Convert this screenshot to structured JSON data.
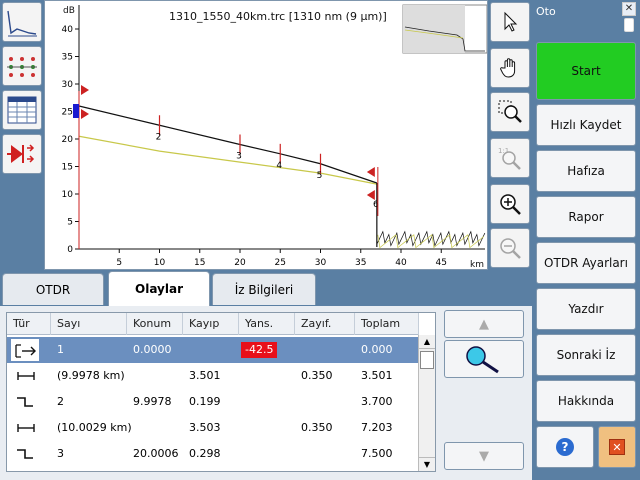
{
  "graph": {
    "title": "1310_1550_40km.trc [1310 nm (9 µm)]",
    "y_unit": "dB",
    "x_unit": "km",
    "y_ticks": [
      "40",
      "35",
      "30",
      "25",
      "20",
      "15",
      "10",
      "5",
      "0"
    ],
    "x_ticks": [
      "5",
      "10",
      "15",
      "20",
      "25",
      "30",
      "35",
      "40",
      "45"
    ],
    "event_labels": [
      "2",
      "3",
      "4",
      "5",
      "6"
    ]
  },
  "left_tools": [
    "trace-view-icon",
    "event-list-icon",
    "table-icon",
    "laser-icon"
  ],
  "tool_col": [
    "pointer-icon",
    "hand-icon",
    "zoom-area-icon",
    "zoom-reset-icon",
    "zoom-in-icon",
    "zoom-out-icon"
  ],
  "right": {
    "title": "Oto",
    "buttons": [
      "Start",
      "Hızlı Kaydet",
      "Hafıza",
      "Rapor",
      "OTDR Ayarları",
      "Yazdır",
      "Sonraki İz",
      "Hakkında"
    ]
  },
  "tabs": [
    "OTDR",
    "Olaylar",
    "İz Bilgileri"
  ],
  "table": {
    "headers": [
      "Tür",
      "Sayı",
      "Konum",
      "Kayıp",
      "Yans.",
      "Zayıf.",
      "Toplam"
    ],
    "rows": [
      {
        "type": "start-icon",
        "sayi": "1",
        "konum": "0.0000",
        "kayip": "",
        "yans": "-42.5",
        "zayif": "",
        "toplam": "0.000"
      },
      {
        "type": "span-icon",
        "sayi": "(9.9978 km)",
        "konum": "",
        "kayip": "3.501",
        "yans": "",
        "zayif": "0.350",
        "toplam": "3.501"
      },
      {
        "type": "splice-icon",
        "sayi": "2",
        "konum": "9.9978",
        "kayip": "0.199",
        "yans": "",
        "zayif": "",
        "toplam": "3.700"
      },
      {
        "type": "span-icon",
        "sayi": "(10.0029 km)",
        "konum": "",
        "kayip": "3.503",
        "yans": "",
        "zayif": "0.350",
        "toplam": "7.203"
      },
      {
        "type": "splice-icon",
        "sayi": "3",
        "konum": "20.0006",
        "kayip": "0.298",
        "yans": "",
        "zayif": "",
        "toplam": "7.500"
      }
    ]
  },
  "colors": {
    "start": "#22cc22",
    "selected": "#6b8fbf",
    "yans_bg": "#e8101a",
    "help": "#2b6bd0",
    "close": "#f0c080"
  }
}
